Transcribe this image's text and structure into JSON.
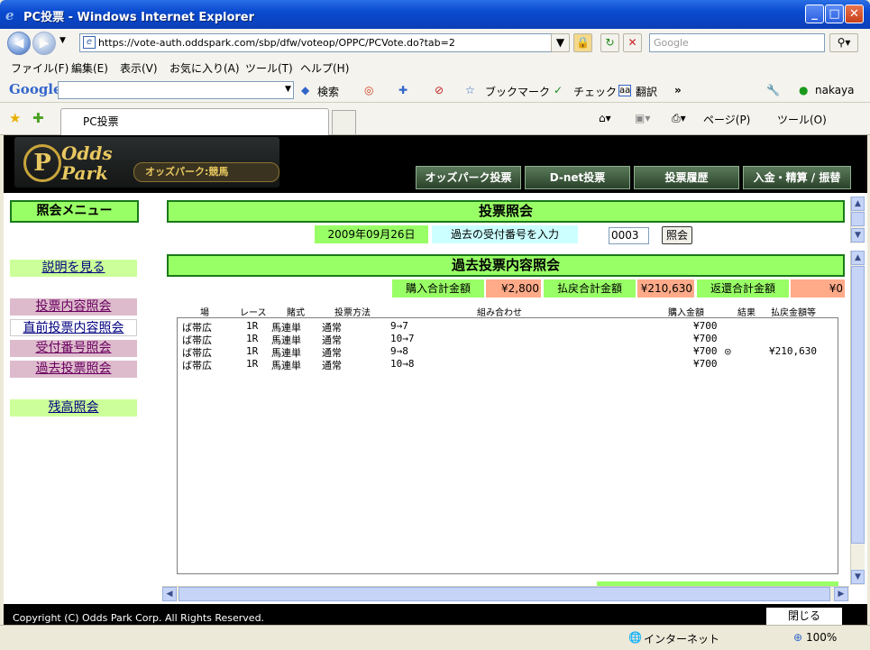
{
  "window": {
    "title": "PC投票 - Windows Internet Explorer"
  },
  "address": {
    "url": "https://vote-auth.oddspark.com/sbp/dfw/voteop/OPPC/PCVote.do?tab=2",
    "search_placeholder": "Google"
  },
  "menu": {
    "items": [
      "ファイル(F)",
      "編集(E)",
      "表示(V)",
      "お気に入り(A)",
      "ツール(T)",
      "ヘルプ(H)"
    ]
  },
  "google_bar": {
    "logo": "Google",
    "search": "検索",
    "bookmark": "ブックマーク",
    "check": "チェック",
    "translate": "翻訳",
    "more": "»",
    "user": "nakaya"
  },
  "tab": {
    "title": "PC投票",
    "page_label": "ページ(P)",
    "tools_label": "ツール(O)"
  },
  "site": {
    "logo_top": "Odds",
    "logo_bottom": "Park",
    "logo_sub": "オッズパーク:競馬",
    "nav": [
      "オッズパーク投票",
      "D-net投票",
      "投票履歴",
      "入金・精算 / 振替"
    ]
  },
  "sidebar": {
    "title": "照会メニュー",
    "items": [
      "説明を見る",
      "投票内容照会",
      "直前投票内容照会",
      "受付番号照会",
      "過去投票照会",
      "残高照会"
    ]
  },
  "inquiry": {
    "title": "投票照会",
    "date": "2009年09月26日",
    "prompt": "過去の受付番号を入力",
    "input_value": "0003",
    "button": "照会"
  },
  "past": {
    "title": "過去投票内容照会",
    "buy_label": "購入合計金額",
    "buy_value": "¥2,800",
    "refund_label": "払戻合計金額",
    "refund_value": "¥210,630",
    "return_label": "返還合計金額",
    "return_value": "¥0",
    "columns": [
      "場",
      "レース",
      "賭式",
      "投票方法",
      "組み合わせ",
      "購入金額",
      "結果",
      "払戻金額等"
    ],
    "rows": [
      [
        "ば帯広",
        "1R",
        "馬連単",
        "通常",
        "9→7",
        "¥700",
        "",
        ""
      ],
      [
        "ば帯広",
        "1R",
        "馬連単",
        "通常",
        "10→7",
        "¥700",
        "",
        ""
      ],
      [
        "ば帯広",
        "1R",
        "馬連単",
        "通常",
        "9→8",
        "¥700",
        "◎",
        "¥210,630"
      ],
      [
        "ば帯広",
        "1R",
        "馬連単",
        "通常",
        "10→8",
        "¥700",
        "",
        ""
      ]
    ]
  },
  "footer": {
    "copyright": "Copyright (C) Odds Park Corp. All Rights Reserved.",
    "close": "閉じる"
  },
  "status": {
    "zone": "インターネット",
    "zoom": "100%"
  }
}
